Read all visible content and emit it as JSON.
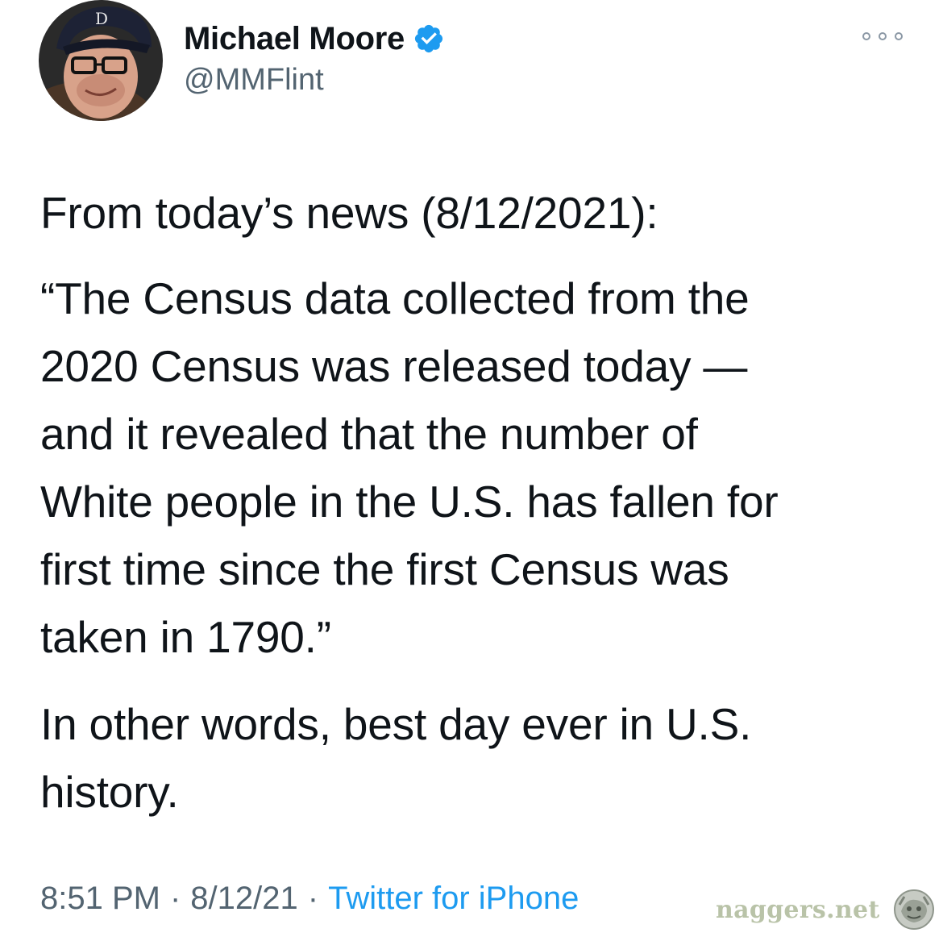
{
  "tweet": {
    "author": {
      "display_name": "Michael Moore",
      "handle": "@MMFlint",
      "verified": true
    },
    "paragraphs": [
      "From today’s news (8/12/2021):",
      "“The Census data collected from the\n2020 Census was released today —\nand it revealed that the number of\nWhite people in the U.S. has fallen for\nfirst time since the first Census was\ntaken in 1790.”",
      "In other words, best day ever in U.S.\nhistory."
    ],
    "meta": {
      "time": "8:51 PM",
      "separator": "·",
      "date": "8/12/21",
      "source": "Twitter for iPhone"
    }
  },
  "watermark": {
    "text": "naggers.net"
  },
  "icons": {
    "more": "more-horizontal-icon",
    "verified": "verified-badge-icon",
    "watermark_logo": "watermark-logo-icon"
  },
  "colors": {
    "text_primary": "#0f1419",
    "text_secondary": "#536471",
    "link": "#1d9bf0",
    "verified": "#1d9bf0",
    "watermark": "#b9c3a8"
  }
}
